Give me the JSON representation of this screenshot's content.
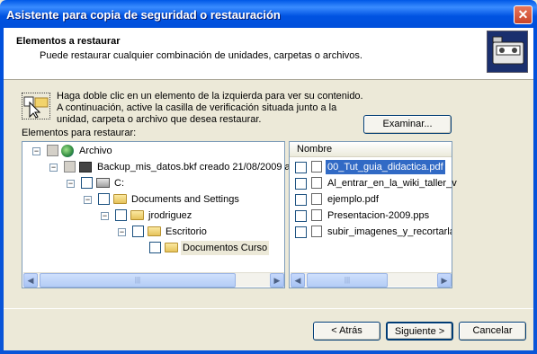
{
  "window": {
    "title": "Asistente para copia de seguridad o restauración",
    "close_glyph": "✕"
  },
  "header": {
    "title": "Elementos a restaurar",
    "subtitle": "Puede restaurar cualquier combinación de unidades, carpetas o archivos."
  },
  "hint": {
    "text": "Haga doble clic en un elemento de la izquierda para ver su contenido. A continuación, active la casilla de verificación situada junto a la unidad, carpeta o archivo que desea restaurar."
  },
  "buttons": {
    "examinar": "Examinar...",
    "atras": "< Atrás",
    "siguiente": "Siguiente >",
    "cancelar": "Cancelar"
  },
  "list_label": "Elementos para restaurar:",
  "tree": {
    "items": [
      {
        "label": "Archivo",
        "icon": "globe-icon"
      },
      {
        "label": "Backup_mis_datos.bkf creado 21/08/2009 a",
        "icon": "backup-disk-icon"
      },
      {
        "label": "C:",
        "icon": "drive-icon"
      },
      {
        "label": "Documents and Settings",
        "icon": "folder-icon"
      },
      {
        "label": "jrodriguez",
        "icon": "folder-icon"
      },
      {
        "label": "Escritorio",
        "icon": "folder-icon"
      },
      {
        "label": "Documentos Curso",
        "icon": "folder-open-icon"
      }
    ]
  },
  "files": {
    "column_header": "Nombre",
    "items": [
      {
        "label": "00_Tut_guia_didactica.pdf",
        "selected": true
      },
      {
        "label": "Al_entrar_en_la_wiki_taller_v"
      },
      {
        "label": "ejemplo.pdf"
      },
      {
        "label": "Presentacion-2009.pps"
      },
      {
        "label": "subir_imagenes_y_recortarlas"
      }
    ]
  },
  "colors": {
    "title_bar": "#0053e1",
    "selection": "#316ac5",
    "dialog_bg": "#ece9d8"
  }
}
